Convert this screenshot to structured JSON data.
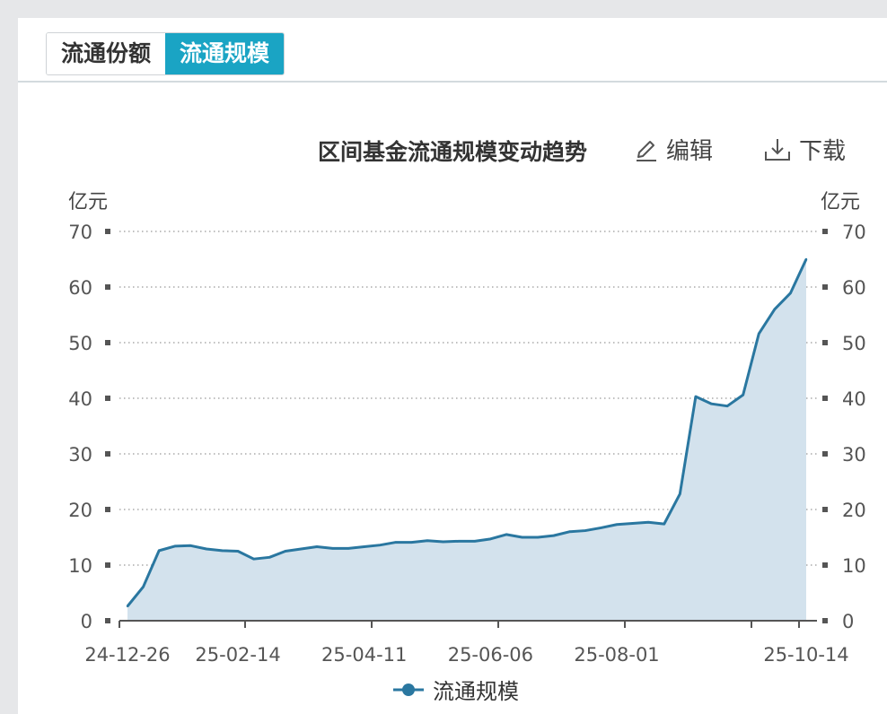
{
  "tabs": [
    {
      "label": "流通份额",
      "active": false
    },
    {
      "label": "流通规模",
      "active": true
    }
  ],
  "toolbar": {
    "edit_label": "编辑",
    "download_label": "下载"
  },
  "colors": {
    "accent": "#1aa4c4",
    "line": "#2a77a0",
    "area": "#d3e2ed",
    "grid": "#999999"
  },
  "chart_data": {
    "type": "area",
    "title": "区间基金流通规模变动趋势",
    "ylabel_left": "亿元",
    "ylabel_right": "亿元",
    "ylim": [
      0,
      70
    ],
    "yticks": [
      0,
      10,
      20,
      30,
      40,
      50,
      60,
      70
    ],
    "xtick_labels": [
      "24-12-26",
      "25-02-14",
      "25-04-11",
      "25-06-06",
      "25-08-01",
      "25-10-14"
    ],
    "xtick_index": [
      0,
      7,
      15,
      23,
      31,
      43
    ],
    "grid": true,
    "legend": "bottom-center",
    "series": [
      {
        "name": "流通规模",
        "values": [
          2.6,
          6.1,
          12.6,
          13.4,
          13.5,
          12.9,
          12.6,
          12.5,
          11.1,
          11.4,
          12.5,
          12.9,
          13.3,
          13.0,
          13.0,
          13.3,
          13.6,
          14.1,
          14.1,
          14.4,
          14.2,
          14.3,
          14.3,
          14.7,
          15.5,
          15.0,
          15.0,
          15.3,
          16.0,
          16.2,
          16.7,
          17.3,
          17.5,
          17.7,
          17.4,
          22.8,
          40.3,
          39.0,
          38.6,
          40.6,
          51.6,
          56.0,
          58.9,
          65.0
        ]
      }
    ]
  }
}
